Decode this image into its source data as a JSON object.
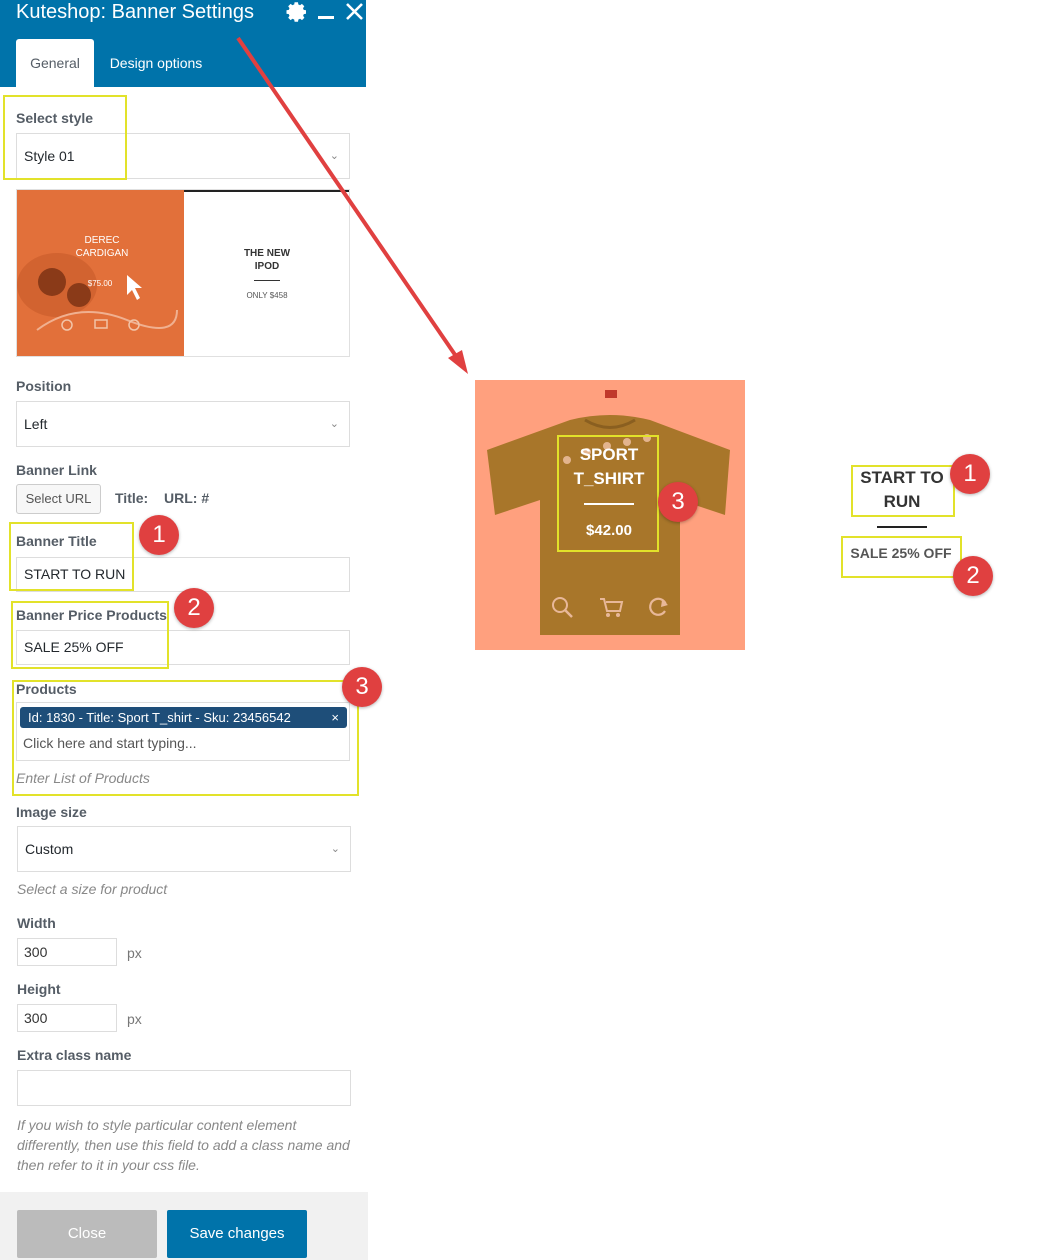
{
  "window": {
    "title": "Kuteshop: Banner Settings",
    "icons": [
      "gear-icon",
      "minimize-icon",
      "close-icon"
    ]
  },
  "tabs": [
    {
      "label": "General",
      "active": true
    },
    {
      "label": "Design options",
      "active": false
    }
  ],
  "form": {
    "select_style": {
      "label": "Select style",
      "value": "Style 01"
    },
    "style_preview": {
      "left": {
        "name": "DEREC CARDIGAN",
        "price": "$75.00"
      },
      "right": {
        "title": "THE NEW IPOD",
        "price": "ONLY $458"
      }
    },
    "position": {
      "label": "Position",
      "value": "Left"
    },
    "banner_link": {
      "label": "Banner Link",
      "button": "Select URL",
      "title_label": "Title:",
      "url_label": "URL: #"
    },
    "banner_title": {
      "label": "Banner Title",
      "value": "START TO RUN"
    },
    "banner_price": {
      "label": "Banner Price Products",
      "value": "SALE 25% OFF"
    },
    "products": {
      "label": "Products",
      "chip": "Id: 1830 - Title: Sport T_shirt - Sku: 23456542",
      "placeholder": "Click here and start typing...",
      "hint": "Enter List of Products"
    },
    "image_size": {
      "label": "Image size",
      "value": "Custom",
      "hint": "Select a size for product"
    },
    "width": {
      "label": "Width",
      "value": "300",
      "unit": "px"
    },
    "height": {
      "label": "Height",
      "value": "300",
      "unit": "px"
    },
    "extra_class": {
      "label": "Extra class name",
      "value": "",
      "hint_lines": [
        "If you wish to style particular content element",
        "differently, then use this field to add a class name and",
        "then refer to it in your css file."
      ]
    }
  },
  "footer": {
    "close": "Close",
    "save": "Save changes"
  },
  "preview": {
    "product_title_line1": "SPORT",
    "product_title_line2": "T_SHIRT",
    "product_price": "$42.00",
    "banner_title_line1": "START TO",
    "banner_title_line2": "RUN",
    "banner_price": "SALE 25% OFF"
  },
  "badges": {
    "one": "1",
    "two": "2",
    "three": "3"
  },
  "colors": {
    "header": "#0073aa",
    "highlight": "#e2e22a",
    "badge": "#e04040",
    "arrow": "#e04040",
    "card": "#ffa07e"
  }
}
